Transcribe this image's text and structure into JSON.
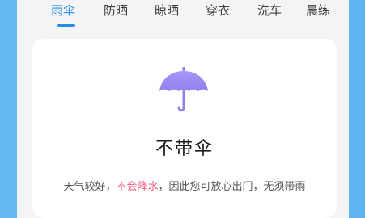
{
  "tabs": [
    {
      "label": "雨伞",
      "active": true
    },
    {
      "label": "防晒",
      "active": false
    },
    {
      "label": "晾晒",
      "active": false
    },
    {
      "label": "穿衣",
      "active": false
    },
    {
      "label": "洗车",
      "active": false
    },
    {
      "label": "晨练",
      "active": false
    }
  ],
  "card": {
    "icon": "umbrella-icon",
    "title": "不带伞",
    "desc_prefix": "天气较好，",
    "desc_highlight": "不会降水",
    "desc_suffix": "，因此您可放心出门，无须带雨"
  },
  "colors": {
    "accent": "#2b8be6",
    "highlight": "#f05a7e",
    "umbrella": "#9b8cf2"
  }
}
